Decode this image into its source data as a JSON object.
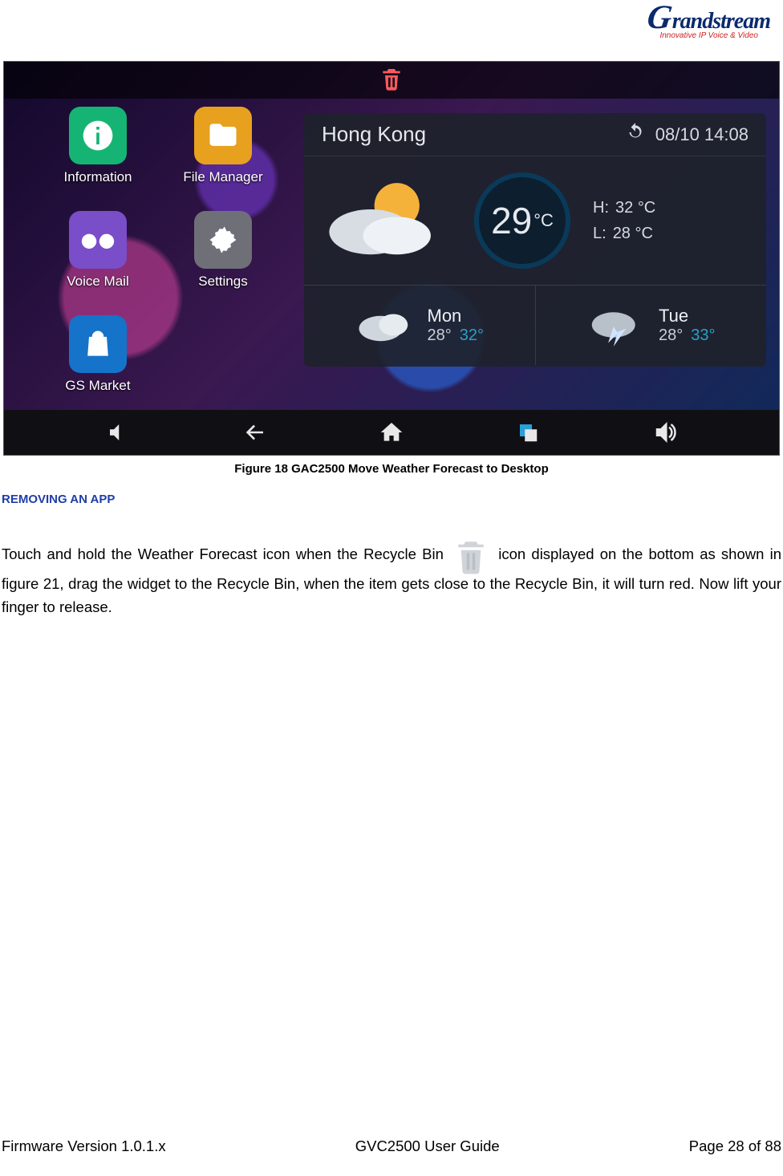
{
  "logo": {
    "brand_g": "G",
    "brand_rest": "randstream",
    "tagline": "Innovative IP Voice & Video"
  },
  "apps": [
    {
      "id": "info",
      "label": "Information",
      "color": "green"
    },
    {
      "id": "files",
      "label": "File Manager",
      "color": "yellow"
    },
    {
      "id": "vmail",
      "label": "Voice Mail",
      "color": "purple"
    },
    {
      "id": "settings",
      "label": "Settings",
      "color": "grey"
    },
    {
      "id": "market",
      "label": "GS Market",
      "color": "blue"
    }
  ],
  "weather": {
    "city": "Hong Kong",
    "datetime": "08/10 14:08",
    "temp": "29",
    "temp_unit": "°C",
    "high_label": "H:",
    "high": "32",
    "high_unit": "°C",
    "low_label": "L:",
    "low": "28",
    "low_unit": "°C",
    "days": [
      {
        "name": "Mon",
        "lo": "28°",
        "hi": "32°"
      },
      {
        "name": "Tue",
        "lo": "28°",
        "hi": "33°"
      }
    ]
  },
  "caption": "Figure 18 GAC2500 Move Weather Forecast to Desktop",
  "section_title": "REMOVING AN APP",
  "body": {
    "p1a": "Touch and hold the Weather Forecast icon when the Recycle Bin",
    "p1b": "icon displayed on the bottom as shown in figure 21, drag the widget to the Recycle Bin, when the item gets close to the Recycle Bin, it will turn red. Now lift your finger to release."
  },
  "footer": {
    "left": "Firmware Version 1.0.1.x",
    "center": "GVC2500 User Guide",
    "right": "Page 28 of 88"
  }
}
